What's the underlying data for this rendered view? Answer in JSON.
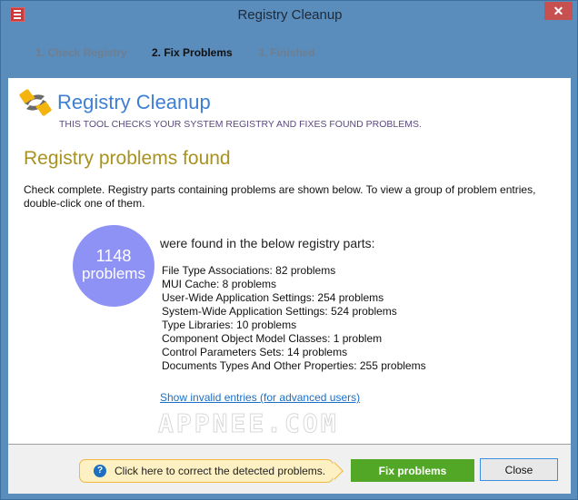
{
  "window": {
    "title": "Registry Cleanup",
    "close_glyph": "✕"
  },
  "steps": [
    {
      "label": "1. Check Registry",
      "state": "done"
    },
    {
      "label": "2. Fix Problems",
      "state": "active"
    },
    {
      "label": "3. Finished",
      "state": "pending"
    }
  ],
  "header": {
    "app_name": "Registry Cleanup",
    "subtitle": "THIS TOOL CHECKS YOUR SYSTEM REGISTRY AND FIXES FOUND PROBLEMS."
  },
  "main": {
    "section_title": "Registry problems found",
    "description": "Check complete. Registry parts containing problems are shown below. To view a group of problem entries, double-click one of them.",
    "total_count": "1148",
    "total_label": "problems",
    "found_text": "were found in the below registry parts:",
    "problem_groups": [
      {
        "label": "File Type Associations: 82 problems"
      },
      {
        "label": "MUI Cache: 8 problems"
      },
      {
        "label": "User-Wide Application Settings: 254 problems"
      },
      {
        "label": "System-Wide Application Settings: 524 problems"
      },
      {
        "label": "Type Libraries: 10 problems"
      },
      {
        "label": "Component Object Model Classes: 1 problem"
      },
      {
        "label": "Control Parameters Sets: 14 problems"
      },
      {
        "label": "Documents Types And Other Properties: 255 problems"
      }
    ],
    "advanced_link": "Show invalid entries (for advanced users)",
    "watermark": "APPNEE.COM"
  },
  "footer": {
    "hint_icon": "?",
    "hint_text": "Click here to correct the detected problems.",
    "fix_label": "Fix problems",
    "close_label": "Close"
  },
  "colors": {
    "window_frame": "#5a8cbc",
    "accent_title": "#3d7fd4",
    "section_title": "#a89220",
    "circle": "#8f92f5",
    "fix_button": "#52a826",
    "close_x": "#c75050"
  }
}
